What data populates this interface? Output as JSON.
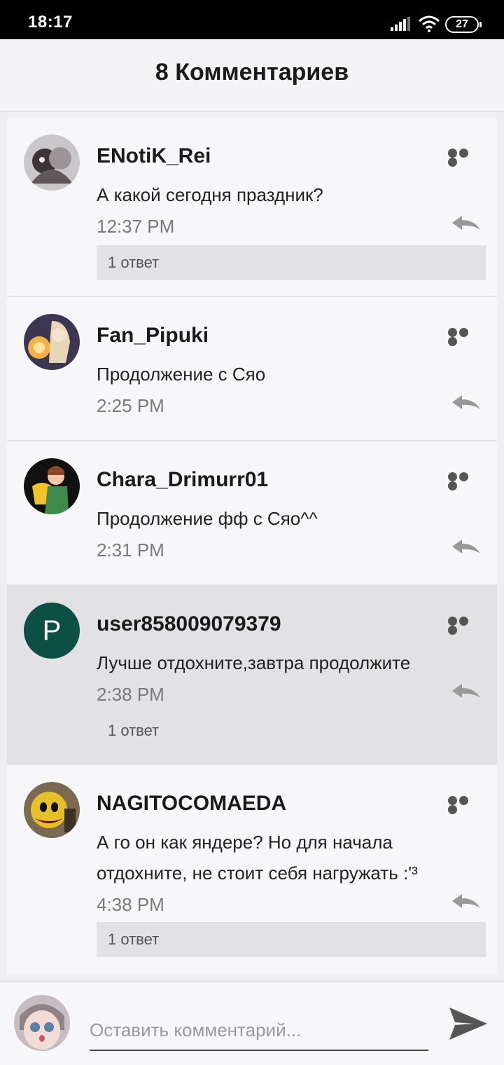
{
  "status_bar": {
    "time": "18:17",
    "battery": "27"
  },
  "header": {
    "title": "8 Комментариев"
  },
  "comments": [
    {
      "username": "ENotiK_Rei",
      "text": "А какой сегодня праздник?",
      "time": "12:37 PM",
      "replies": "1 ответ"
    },
    {
      "username": "Fan_Pipuki",
      "text": "Продолжение с Сяо",
      "time": "2:25 PM"
    },
    {
      "username": "Chara_Drimurr01",
      "text": "Продолжение фф с Сяо^^",
      "time": "2:31 PM"
    },
    {
      "username": "user858009079379",
      "avatar_letter": "P",
      "text": "Лучше отдохните,завтра продолжите",
      "time": "2:38 PM",
      "replies": "1 ответ"
    },
    {
      "username": "NAGITOCOMAEDA",
      "text_line1": "А го он как яндере? Но для начала",
      "text_line2": "отдохните, не стоит себя нагружать :'³",
      "time": "4:38 PM",
      "replies": "1 ответ"
    }
  ],
  "footer": {
    "placeholder": "Оставить комментарий..."
  },
  "colors": {
    "letter_avatar": "#0b4f45",
    "highlight_row": "#e2e1e4",
    "background": "#f7f6f9"
  },
  "icons": [
    "signal-icon",
    "wifi-icon",
    "battery-icon",
    "more-icon",
    "reply-icon",
    "send-icon"
  ]
}
